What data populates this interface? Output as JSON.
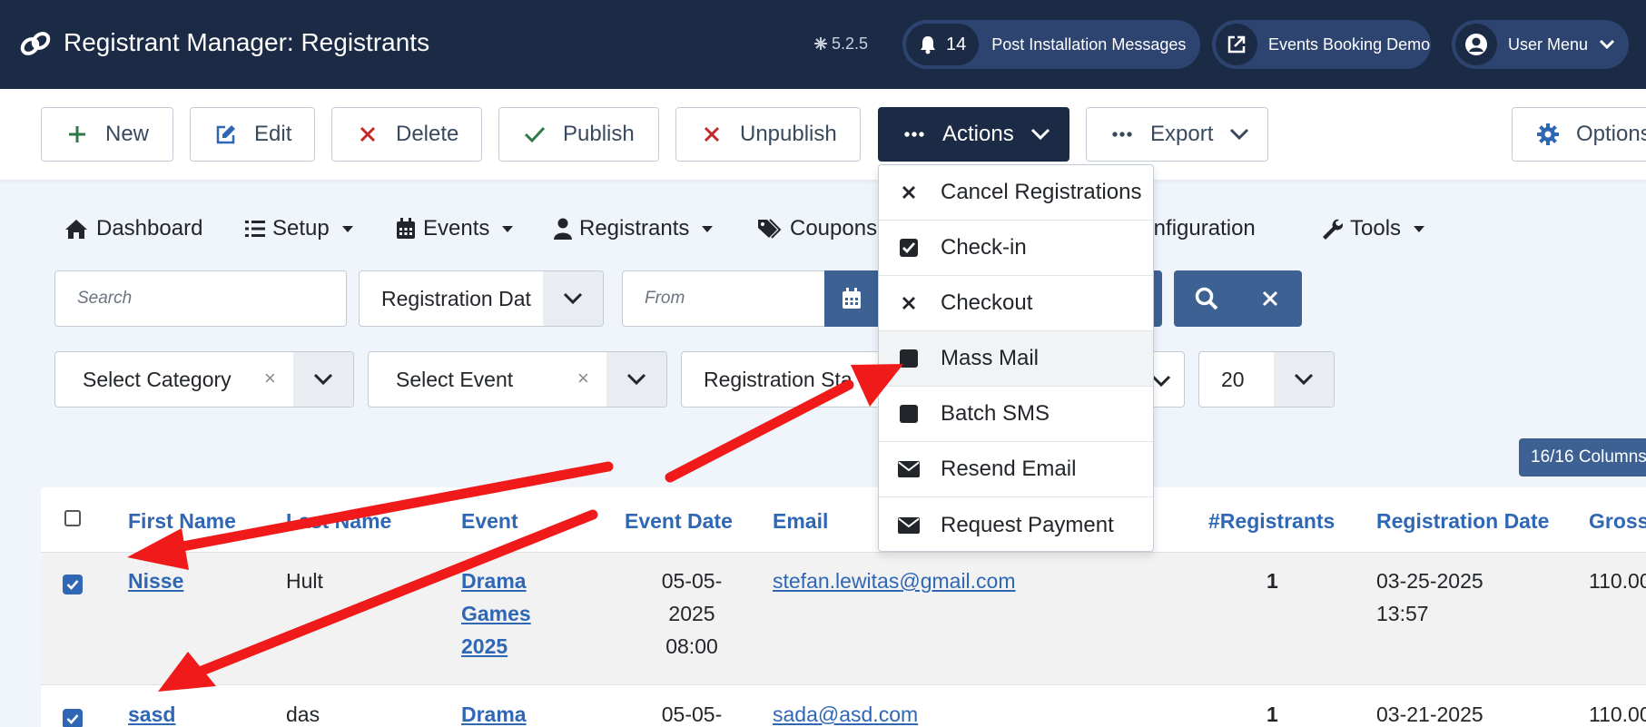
{
  "header": {
    "title": "Registrant Manager: Registrants",
    "version": "5.2.5",
    "post_install_count": "14",
    "post_install_label": "Post Installation Messages",
    "demo_label": "Events Booking Demo",
    "user_menu_label": "User Menu"
  },
  "toolbar": {
    "new": "New",
    "edit": "Edit",
    "delete": "Delete",
    "publish": "Publish",
    "unpublish": "Unpublish",
    "actions": "Actions",
    "export": "Export",
    "options": "Options"
  },
  "nav": {
    "dashboard": "Dashboard",
    "setup": "Setup",
    "events": "Events",
    "registrants": "Registrants",
    "coupons": "Coupons",
    "configuration": "Configuration",
    "tools": "Tools"
  },
  "filters": {
    "search_placeholder": "Search",
    "date_type": "Registration Dat",
    "from_placeholder": "From",
    "category": "Select Category",
    "event": "Select Event",
    "status": "Registration Sta",
    "limit": "20",
    "columns": "16/16 Columns"
  },
  "actions_menu": [
    {
      "label": "Cancel Registrations",
      "icon": "x-icon"
    },
    {
      "label": "Check-in",
      "icon": "checkbox-checked-icon"
    },
    {
      "label": "Checkout",
      "icon": "x-icon"
    },
    {
      "label": "Mass Mail",
      "icon": "square-icon"
    },
    {
      "label": "Batch SMS",
      "icon": "square-icon"
    },
    {
      "label": "Resend Email",
      "icon": "envelope-icon"
    },
    {
      "label": "Request Payment",
      "icon": "envelope-icon"
    }
  ],
  "table": {
    "columns": [
      "First Name",
      "Last Name",
      "Event",
      "Event Date",
      "Email",
      "#Registrants",
      "Registration Date",
      "Gross"
    ],
    "rows": [
      {
        "first_name": "Nisse",
        "last_name": "Hult",
        "event_lines": [
          "Drama",
          "Games",
          "2025"
        ],
        "event_date_lines": [
          "05-05-",
          "2025",
          "08:00"
        ],
        "email": "stefan.lewitas@gmail.com",
        "registrants": "1",
        "reg_date_lines": [
          "03-25-2025",
          "13:57"
        ],
        "gross": "110.00",
        "checked": true
      },
      {
        "first_name": "sasd",
        "last_name": "das",
        "event_lines": [
          "Drama"
        ],
        "event_date_lines": [
          "05-05-"
        ],
        "email": "sada@asd.com",
        "registrants": "1",
        "reg_date_lines": [
          "03-21-2025"
        ],
        "gross": "110.00",
        "checked": true
      }
    ]
  },
  "colors": {
    "header_bg": "#1c2b45",
    "accent_blue": "#2f67b5",
    "button_blue": "#3d6193",
    "annotation_red": "#f01a1a"
  }
}
